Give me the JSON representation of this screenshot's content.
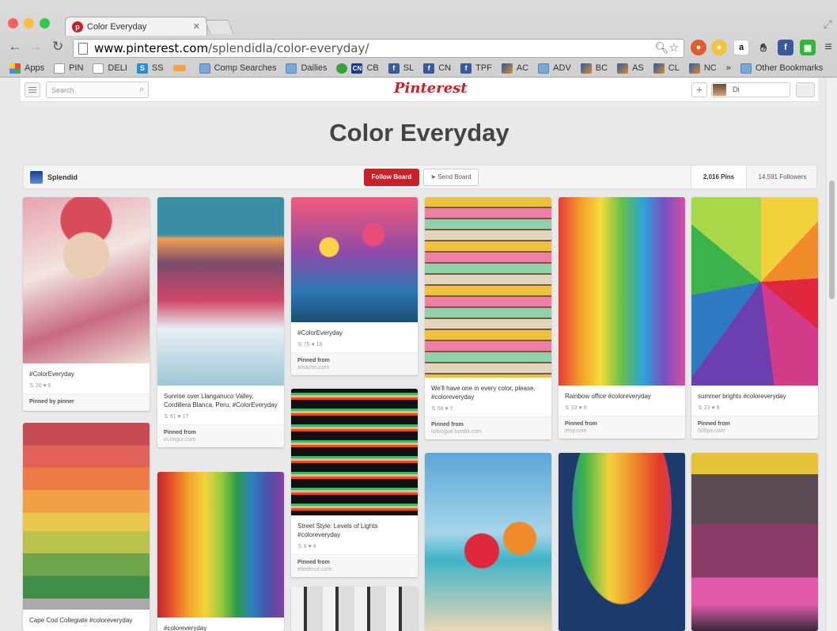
{
  "browser": {
    "tab_title": "Color Everyday",
    "url_host": "www.pinterest.com",
    "url_path": "/splendidla/color-everyday/",
    "bookmarks": [
      "Apps",
      "PIN",
      "DELI",
      "SS",
      "",
      "Comp Searches",
      "Dailies",
      "CB",
      "SL",
      "CN",
      "TPF",
      "AC",
      "ADV",
      "BC",
      "AS",
      "CL",
      "NC",
      "»",
      "Other Bookmarks"
    ]
  },
  "site": {
    "search_placeholder": "Search",
    "logo": "Pinterest",
    "user_name": "Di"
  },
  "board": {
    "title": "Color Everyday",
    "owner": "Splendid",
    "follow_label": "Follow Board",
    "send_label": "Send Board",
    "pins_count": "2,016 Pins",
    "followers_count": "14,591 Followers"
  },
  "pins": [
    {
      "desc": "#ColorEveryday",
      "meta": "⇅ 20 ♥ 6",
      "src_label": "Pinned by pinner",
      "src": ""
    },
    {
      "desc": "Cape Cod Collegiate #coloreveryday",
      "meta": "",
      "src_label": "",
      "src": ""
    },
    {
      "desc": "Sunrise over Llanganuco Valley, Cordillera Blanca, Peru. #ColorEveryday",
      "meta": "⇅ 91 ♥ 17",
      "src_label": "Pinned from",
      "src": "m.imgur.com"
    },
    {
      "desc": "#coloreveryday",
      "meta": "",
      "src_label": "",
      "src": ""
    },
    {
      "desc": "#ColorEveryday",
      "meta": "⇅ 75 ♥ 18",
      "src_label": "Pinned from",
      "src": "amazon.com"
    },
    {
      "desc": "Street Style: Levels of Lights #coloreveryday",
      "meta": "⇅ 8 ♥ 4",
      "src_label": "Pinned from",
      "src": "elledecor.com"
    },
    {
      "desc": "We'll have one in every color, please. #coloreveryday",
      "meta": "⇅ 58 ♥ 7",
      "src_label": "Pinned from",
      "src": "isitvogue.tumblr.com"
    },
    {
      "desc": "Rainbow office #coloreveryday",
      "meta": "⇅ 33 ♥ 9",
      "src_label": "Pinned from",
      "src": "etsy.com"
    },
    {
      "desc": "summer brights #coloreveryday",
      "meta": "⇅ 23 ♥ 8",
      "src_label": "Pinned from",
      "src": "500px.com"
    }
  ]
}
